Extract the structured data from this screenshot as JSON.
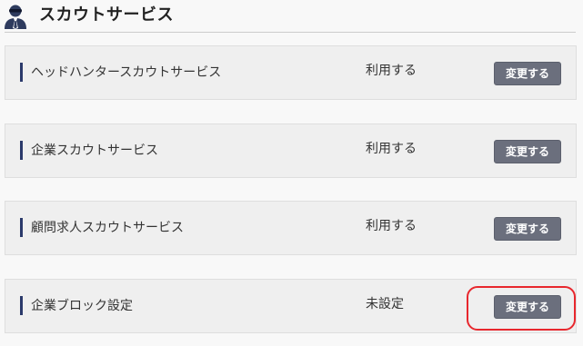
{
  "header": {
    "title": "スカウトサービス",
    "icon": "agent-person-icon"
  },
  "services": [
    {
      "label": "ヘッドハンタースカウトサービス",
      "status": "利用する",
      "button_label": "変更する"
    },
    {
      "label": "企業スカウトサービス",
      "status": "利用する",
      "button_label": "変更する"
    },
    {
      "label": "顧問求人スカウトサービス",
      "status": "利用する",
      "button_label": "変更する"
    },
    {
      "label": "企業ブロック設定",
      "status": "未設定",
      "button_label": "変更する"
    }
  ],
  "colors": {
    "accent_bar": "#2b3a6b",
    "button_bg": "#6b6f7d",
    "highlight": "#e8272d"
  }
}
